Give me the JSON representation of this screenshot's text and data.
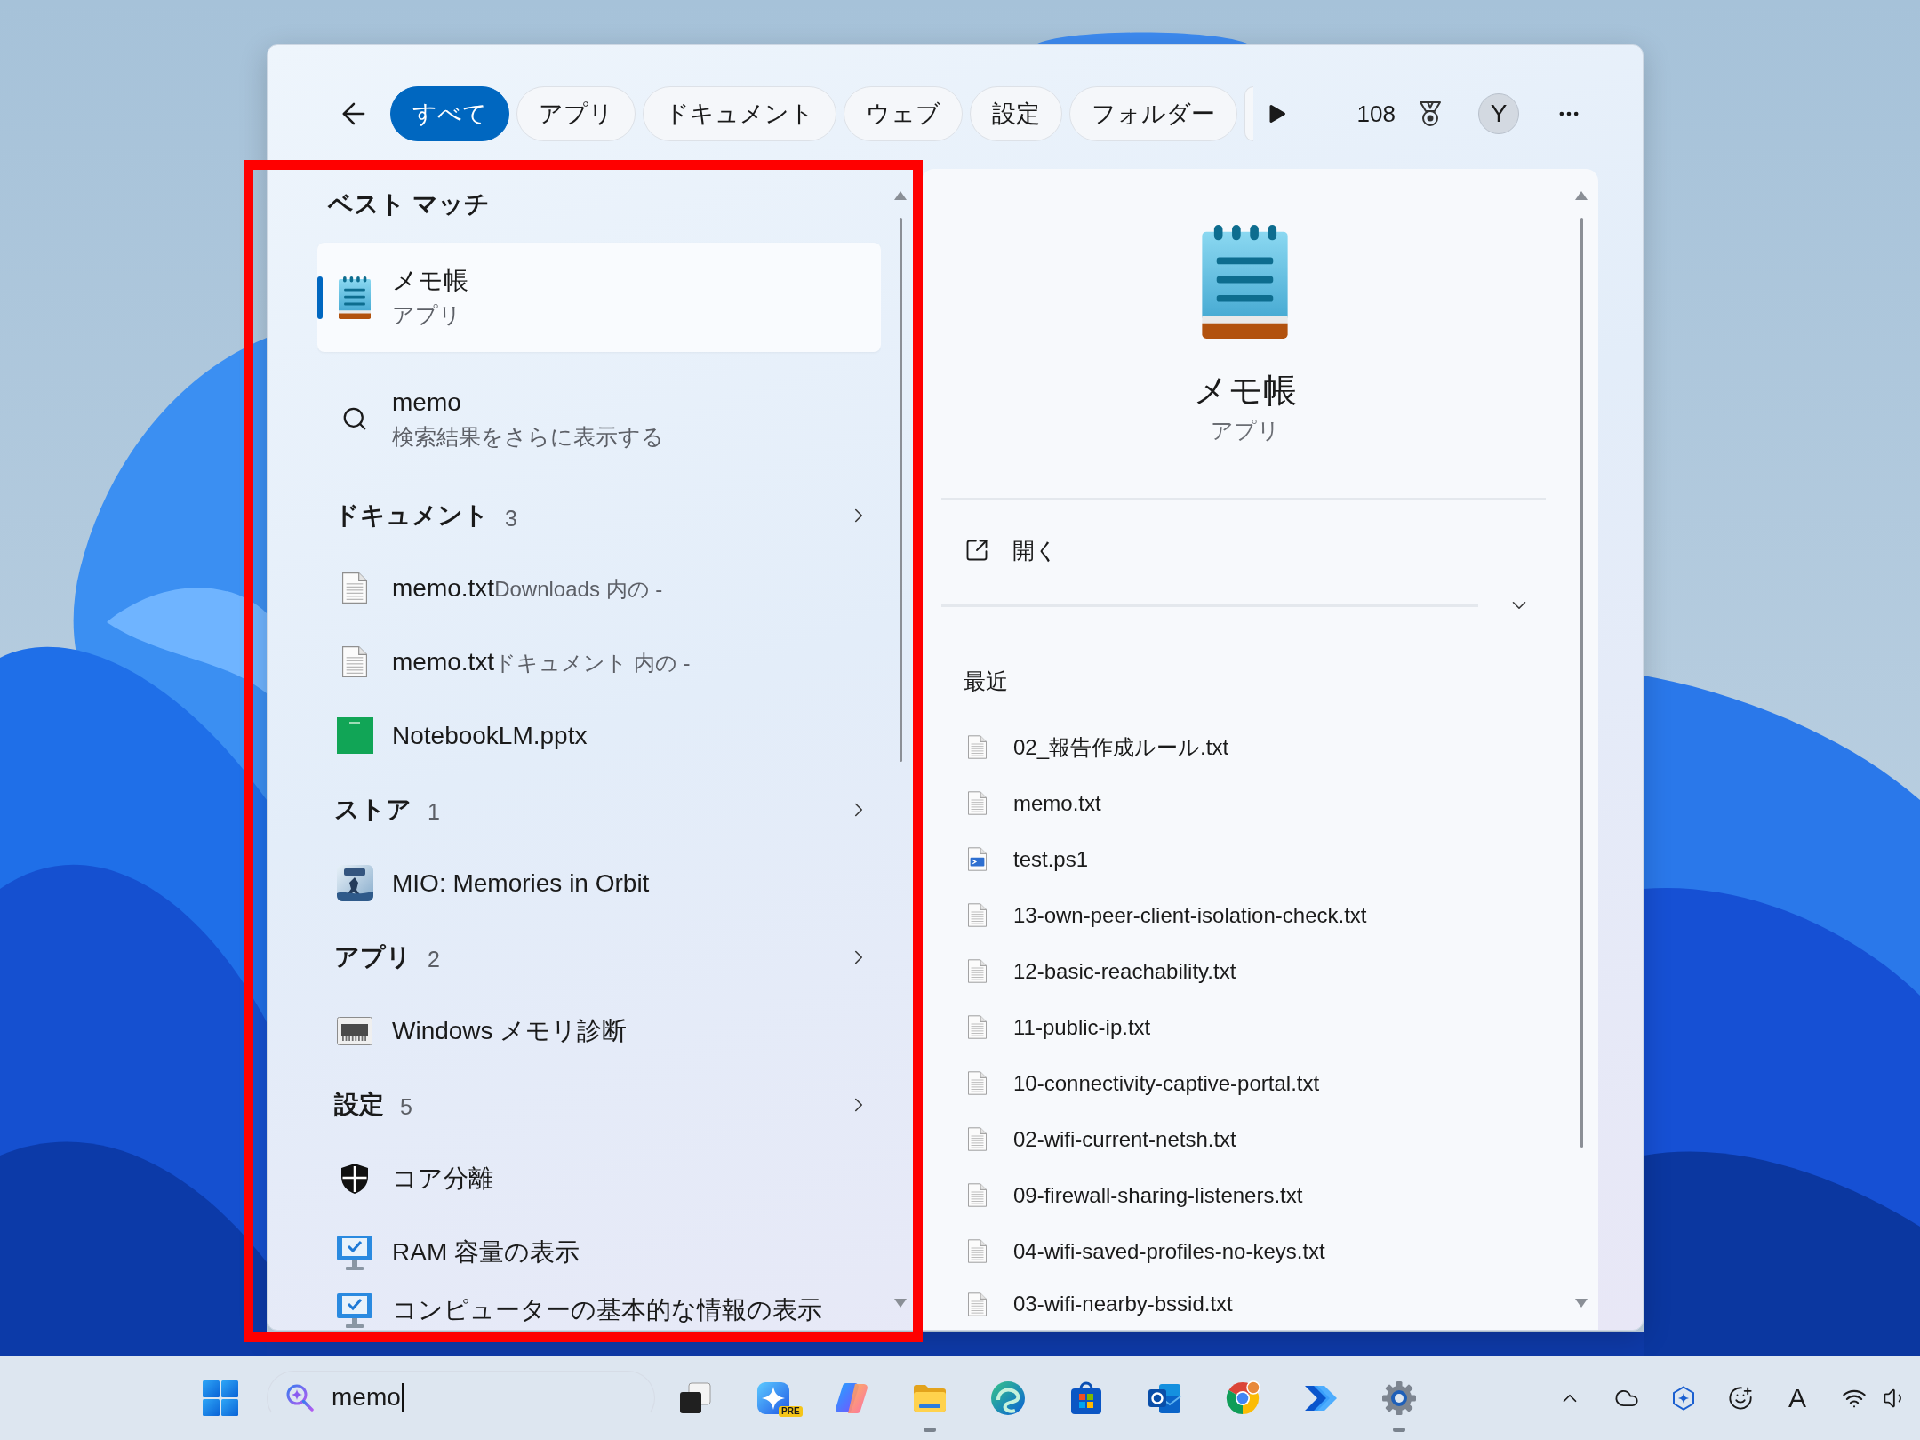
{
  "top_bar": {
    "tabs": [
      {
        "label": "すべて",
        "selected": true
      },
      {
        "label": "アプリ",
        "selected": false
      },
      {
        "label": "ドキュメント",
        "selected": false
      },
      {
        "label": "ウェブ",
        "selected": false
      },
      {
        "label": "設定",
        "selected": false
      },
      {
        "label": "フォルダー",
        "selected": false
      }
    ],
    "points": "108",
    "avatar": "Y"
  },
  "results": {
    "best_match_heading": "ベスト マッチ",
    "best_match": {
      "title": "メモ帳",
      "subtitle": "アプリ",
      "kind": "notepad",
      "selected": true
    },
    "more_results": {
      "title": "memo",
      "subtitle": "検索結果をさらに表示する",
      "selected": false
    },
    "sections": [
      {
        "heading": "ドキュメント",
        "count": "3",
        "items": [
          {
            "name": "memo.txt",
            "location": "Downloads 内の -",
            "kind": "text-file",
            "selected": false
          },
          {
            "name": "memo.txt",
            "location": "ドキュメント 内の -",
            "kind": "text-file",
            "selected": false
          },
          {
            "name": "NotebookLM.pptx",
            "kind": "presentation",
            "selected": false
          }
        ]
      },
      {
        "heading": "ストア",
        "count": "1",
        "items": [
          {
            "name": "MIO: Memories in Orbit",
            "kind": "game",
            "selected": false
          }
        ]
      },
      {
        "heading": "アプリ",
        "count": "2",
        "items": [
          {
            "name": "Windows メモリ診断",
            "kind": "chip",
            "selected": false
          }
        ]
      },
      {
        "heading": "設定",
        "count": "5",
        "items": [
          {
            "name": "コア分離",
            "kind": "shield",
            "selected": false
          },
          {
            "name": "RAM 容量の表示",
            "kind": "monitor",
            "selected": false
          },
          {
            "name": "コンピューターの基本的な情報の表示",
            "kind": "monitor",
            "selected": false
          }
        ]
      }
    ]
  },
  "detail": {
    "title": "メモ帳",
    "subtitle": "アプリ",
    "kind": "notepad",
    "actions": [
      {
        "label": "開く",
        "kind": "open"
      }
    ],
    "recent_heading": "最近",
    "recent": [
      {
        "name": "02_報告作成ルール.txt",
        "kind": "text-file"
      },
      {
        "name": "memo.txt",
        "kind": "text-file"
      },
      {
        "name": "test.ps1",
        "kind": "script"
      },
      {
        "name": "13-own-peer-client-isolation-check.txt",
        "kind": "text-file"
      },
      {
        "name": "12-basic-reachability.txt",
        "kind": "text-file"
      },
      {
        "name": "11-public-ip.txt",
        "kind": "text-file"
      },
      {
        "name": "10-connectivity-captive-portal.txt",
        "kind": "text-file"
      },
      {
        "name": "02-wifi-current-netsh.txt",
        "kind": "text-file"
      },
      {
        "name": "09-firewall-sharing-listeners.txt",
        "kind": "text-file"
      },
      {
        "name": "04-wifi-saved-profiles-no-keys.txt",
        "kind": "text-file"
      },
      {
        "name": "03-wifi-nearby-bssid.txt",
        "kind": "text-file"
      }
    ]
  },
  "taskbar": {
    "search": {
      "value": "memo"
    },
    "apps": [
      {
        "kind": "task-view",
        "running": false
      },
      {
        "kind": "sparkle",
        "badge": "PRE",
        "running": false
      },
      {
        "kind": "swirl",
        "running": false
      },
      {
        "kind": "folder",
        "running": true
      },
      {
        "kind": "wave",
        "running": false
      },
      {
        "kind": "bag",
        "running": false
      },
      {
        "kind": "mail",
        "running": false
      },
      {
        "kind": "browser",
        "running": false
      },
      {
        "kind": "chevrons",
        "running": false
      },
      {
        "kind": "gear",
        "running": true
      }
    ],
    "ime_label": "A"
  }
}
